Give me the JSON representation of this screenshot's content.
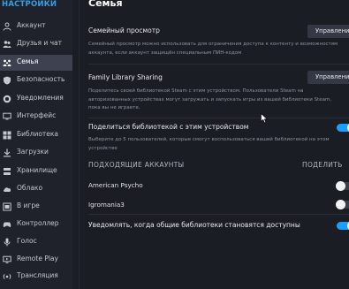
{
  "sidebar": {
    "title": "НАСТРОЙКИ",
    "items": [
      {
        "label": "Аккаунт",
        "icon": "user-icon"
      },
      {
        "label": "Друзья и чат",
        "icon": "friends-icon"
      },
      {
        "label": "Семья",
        "icon": "family-icon",
        "active": true
      },
      {
        "label": "Безопасность",
        "icon": "shield-icon"
      },
      {
        "label": "Уведомления",
        "icon": "bell-icon"
      },
      {
        "label": "Интерфейс",
        "icon": "monitor-icon"
      },
      {
        "label": "Библиотека",
        "icon": "grid-icon"
      },
      {
        "label": "Загрузки",
        "icon": "download-icon"
      },
      {
        "label": "Хранилище",
        "icon": "storage-icon"
      },
      {
        "label": "Облако",
        "icon": "cloud-icon"
      },
      {
        "label": "В игре",
        "icon": "game-icon"
      },
      {
        "label": "Контроллер",
        "icon": "controller-icon"
      },
      {
        "label": "Голос",
        "icon": "microphone-icon"
      },
      {
        "label": "Remote Play",
        "icon": "remote-play-icon"
      },
      {
        "label": "Трансляция",
        "icon": "broadcast-icon"
      }
    ]
  },
  "main": {
    "title": "Семья",
    "family_view": {
      "title": "Семейный просмотр",
      "desc": "Семейный просмотр можно использовать для ограничения доступа к контенту и возможностям аккаунта, если аккаунт защищён специальным ПИН-кодом",
      "button": "Управление"
    },
    "library_sharing": {
      "title": "Family Library Sharing",
      "desc": "Поделитесь своей библиотекой Steam с этим устройством. Пользователи Steam на авторизованных устройствах могут загружать и запускать игры из вашей библиотеки Steam, пока вы не играете.",
      "button": "Управление"
    },
    "share_device": {
      "title": "Поделиться библиотекой с этим устройством",
      "desc": "Выберите до 5 пользователей, которые смогут воспользоваться вашей библиотекой на этом устройстве",
      "enabled": true
    },
    "accounts_header": "ПОДХОДЯЩИЕ АККАУНТЫ",
    "accounts_header_right": "ПОДЕЛИТЬ",
    "accounts": [
      {
        "name": "American Psycho",
        "enabled": false
      },
      {
        "name": "Igromania3",
        "enabled": false
      }
    ],
    "notify": {
      "label": "Уведомлять, когда общие библиотеки становятся доступны",
      "enabled": true
    }
  },
  "colors": {
    "accent": "#1a9fff",
    "sidebar_title": "#3a9ee6",
    "background": "#1b1d24"
  }
}
